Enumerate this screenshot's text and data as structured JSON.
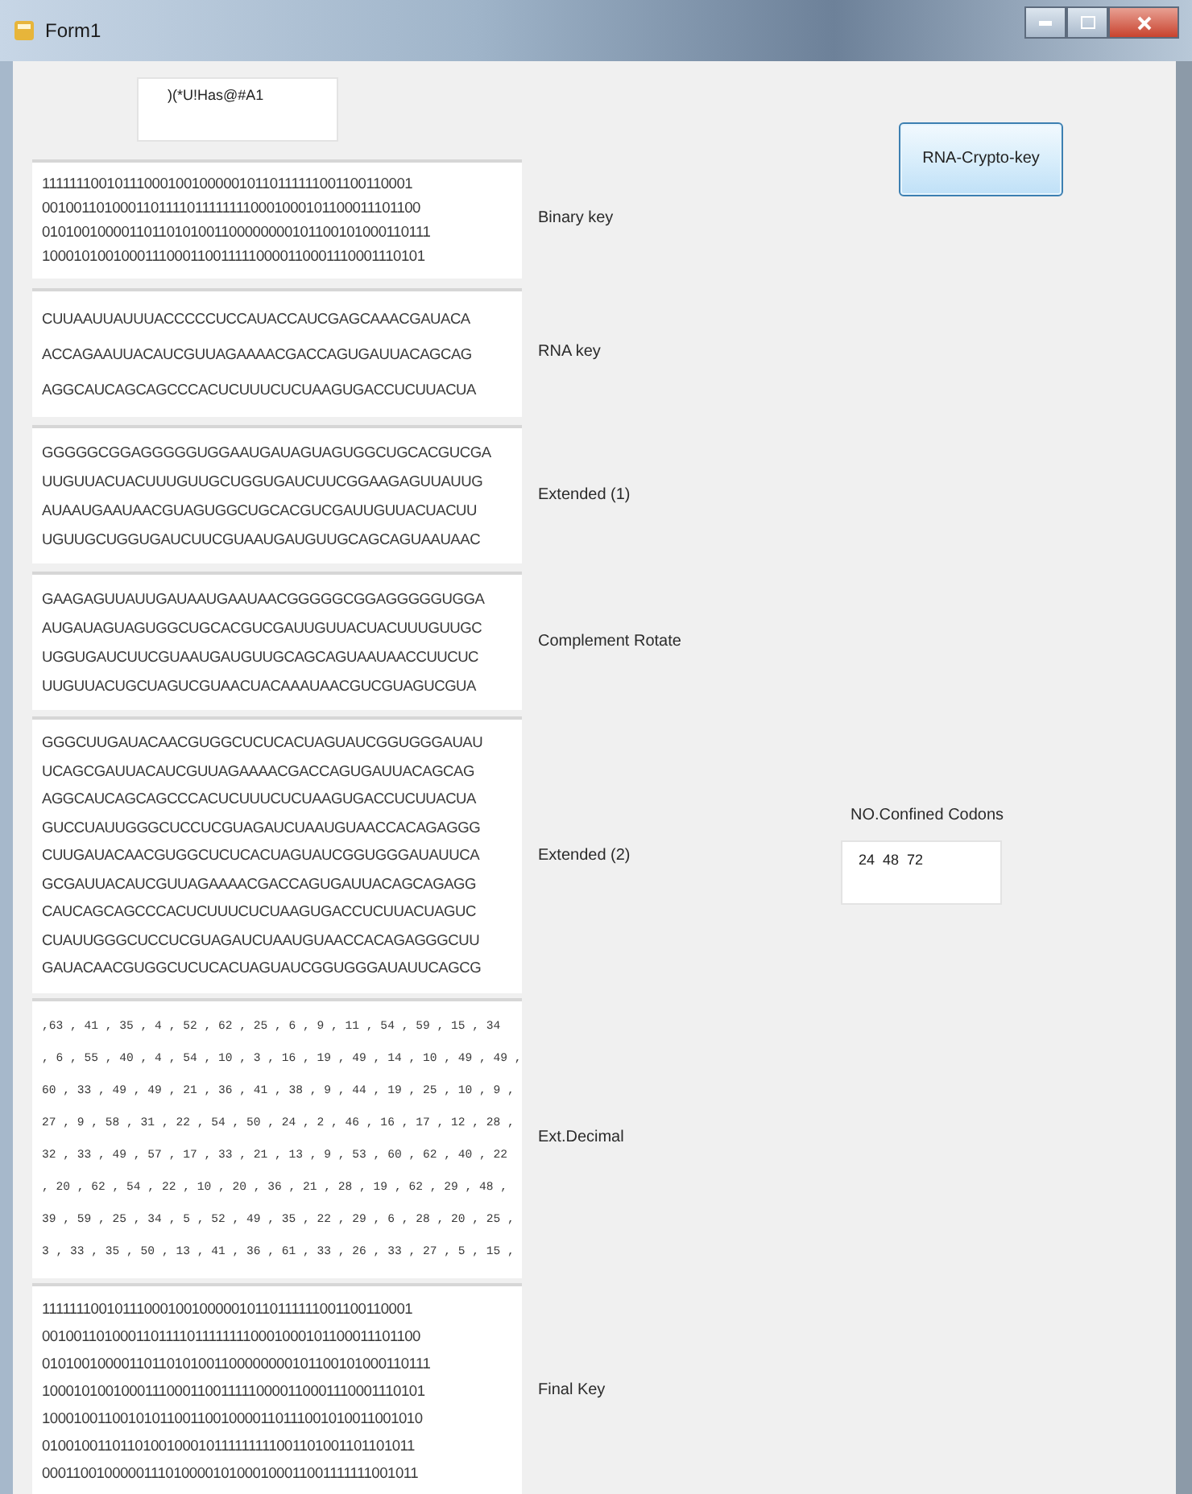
{
  "window": {
    "title": "Form1"
  },
  "key_input": {
    "value": ")(*U!Has@#A1"
  },
  "generate_button": {
    "label": "RNA-Crypto-key"
  },
  "codons": {
    "label": "NO.Confined Codons",
    "value": "24  48  72"
  },
  "outputs": [
    {
      "kind": "text",
      "label": "Binary key",
      "lines": [
        "1111111001011100010010000010110111111001100110001",
        "00100110100011011110111111110001000101100011101100",
        "01010010000110110101001100000000101100101000110111",
        "10001010010001110001100111110000110001110001110101"
      ]
    },
    {
      "kind": "text",
      "label": "RNA key",
      "lines": [
        "CUUAAUUAUUUACCCCCUCCAUACCAUCGAGCAAACGAUACA",
        "ACCAGAAUUACAUCGUUAGAAAACGACCAGUGAUUACAGCAG",
        "AGGCAUCAGCAGCCCACUCUUUCUCUAAGUGACCUCUUACUA"
      ]
    },
    {
      "kind": "text",
      "label": "Extended (1)",
      "lines": [
        "GGGGGCGGAGGGGGUGGAAUGAUAGUAGUGGCUGCACGUCGA",
        "UUGUUACUACUUUGUUGCUGGUGAUCUUCGGAAGAGUUAUUG",
        "AUAAUGAAUAACGUAGUGGCUGCACGUCGAUUGUUACUACUU",
        "UGUUGCUGGUGAUCUUCGUAAUGAUGUUGCAGCAGUAAUAAC"
      ]
    },
    {
      "kind": "text",
      "label": "Complement  Rotate",
      "lines": [
        "GAAGAGUUAUUGAUAAUGAAUAACGGGGGCGGAGGGGGUGGA",
        "AUGAUAGUAGUGGCUGCACGUCGAUUGUUACUACUUUGUUGC",
        "UGGUGAUCUUCGUAAUGAUGUUGCAGCAGUAAUAACCUUCUC",
        "UUGUUACUGCUAGUCGUAACUACAAAUAACGUCGUAGUCGUA"
      ]
    },
    {
      "kind": "text",
      "label": "Extended (2)",
      "lines": [
        "GGGCUUGAUACAACGUGGCUCUCACUAGUAUCGGUGGGAUAU",
        "UCAGCGAUUACAUCGUUAGAAAACGACCAGUGAUUACAGCAG",
        "AGGCAUCAGCAGCCCACUCUUUCUCUAAGUGACCUCUUACUA",
        "GUCCUAUUGGGCUCCUCGUAGAUCUAAUGUAACCACAGAGGG",
        "CUUGAUACAACGUGGCUCUCACUAGUAUCGGUGGGAUAUUCA",
        "GCGAUUACAUCGUUAGAAAACGACCAGUGAUUACAGCAGAGG",
        "CAUCAGCAGCCCACUCUUUCUCUAAGUGACCUCUUACUAGUC",
        "CUAUUGGGCUCCUCGUAGAUCUAAUGUAACCACAGAGGGCUU",
        "GAUACAACGUGGCUCUCACUAGUAUCGGUGGGAUAUUCAGCG"
      ]
    },
    {
      "kind": "mono",
      "label": "Ext.Decimal",
      "lines": [
        ",63 , 41 , 35 , 4 , 52 , 62 , 25 , 6 , 9 , 11 , 54 , 59 , 15 , 34",
        ", 6 , 55 , 40 , 4 , 54 , 10 , 3 , 16 , 19 , 49 , 14 , 10 , 49 , 49 ,",
        "60 , 33 , 49 , 49 , 21 , 36 , 41 , 38 , 9 , 44 , 19 , 25 , 10 , 9 ,",
        "27 , 9 , 58 , 31 , 22 , 54 , 50 , 24 , 2 , 46 , 16 , 17 , 12 , 28 ,",
        "32 , 33 , 49 , 57 , 17 , 33 , 21 , 13 , 9 , 53 , 60 , 62 , 40 , 22",
        ", 20 , 62 , 54 , 22 , 10 , 20 , 36 , 21 , 28 , 19 , 62 , 29 , 48 ,",
        "39 , 59 , 25 , 34 , 5 , 52 , 49 , 35 , 22 , 29 , 6 , 28 , 20 , 25 ,",
        "3 , 33 , 35 , 50 , 13 , 41 , 36 , 61 , 33 , 26 , 33 , 27 , 5 , 15 ,"
      ]
    },
    {
      "kind": "text",
      "label": "Final Key",
      "lines": [
        "1111111001011100010010000010110111111001100110001",
        "00100110100011011110111111110001000101100011101100",
        "01010010000110110101001100000000101100101000110111",
        "10001010010001110001100111110000110001110001110101",
        "1000100110010101100110010000110111001010011001010",
        "0100100110110100100010111111111001101001101101011",
        "0001100100000111010000101000100011001111111001011"
      ]
    }
  ]
}
